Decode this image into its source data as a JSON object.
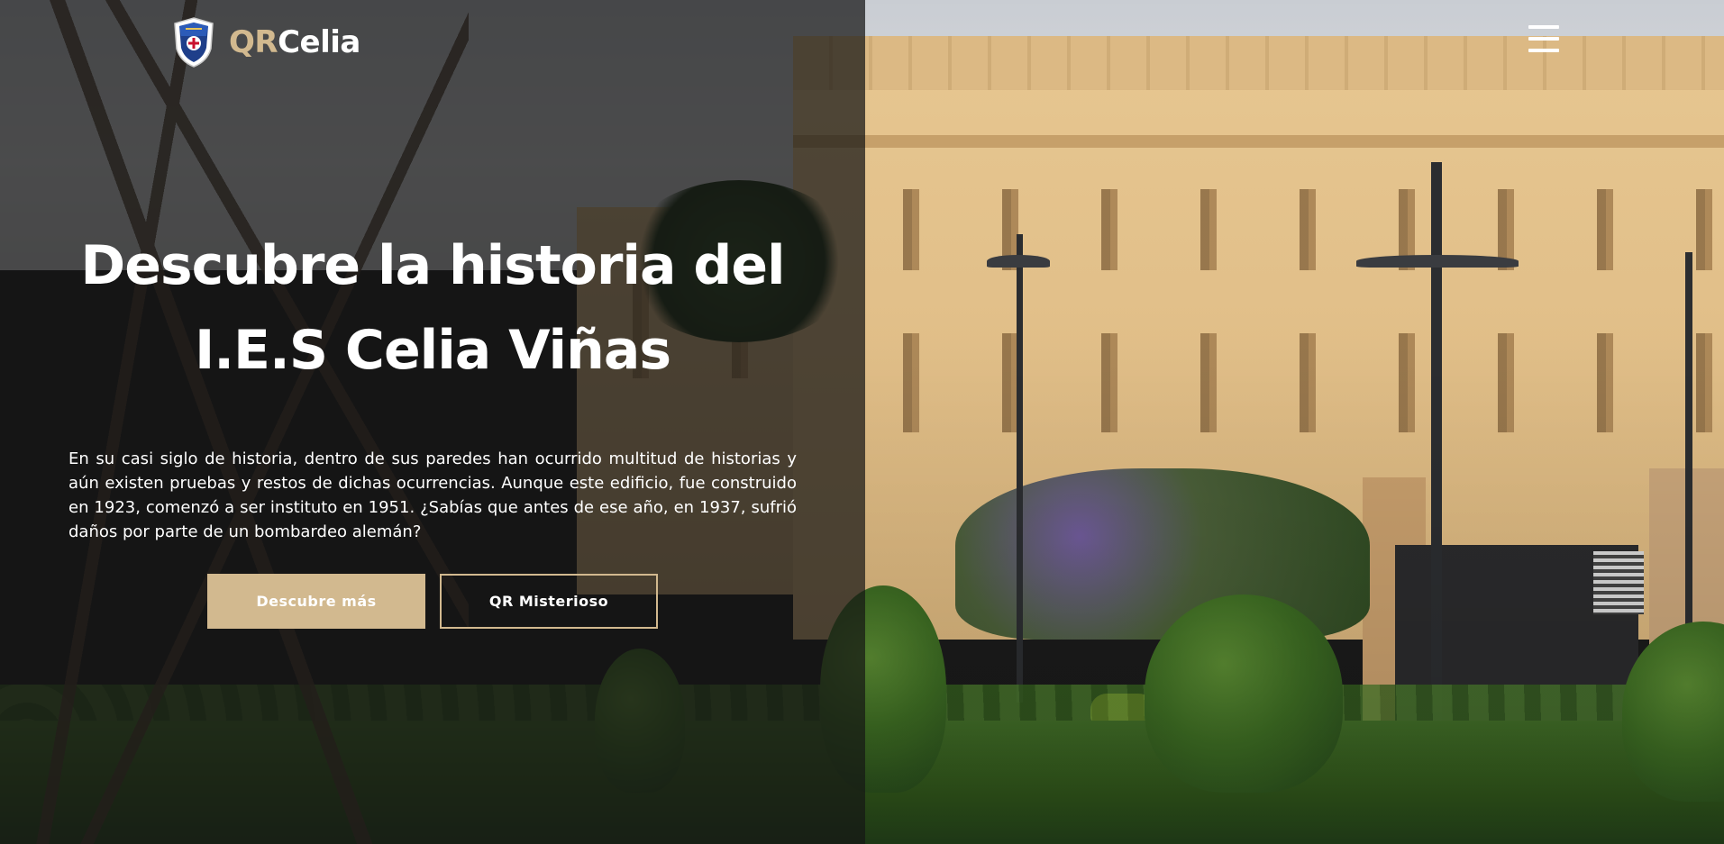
{
  "header": {
    "logo_icon": "school-crest-icon",
    "brand_accent": "QR",
    "brand_main": "Celia",
    "menu_icon": "hamburger-menu-icon"
  },
  "hero": {
    "title_line1": "Descubre la historia del",
    "title_line2": "I.E.S Celia Viñas",
    "description": "En su casi siglo de historia, dentro de sus paredes han ocurrido multitud de historias y aún existen pruebas y restos de dichas ocurrencias. Aunque este edificio, fue construido en 1923, comenzó a ser instituto en 1951. ¿Sabías que antes de ese año, en 1937, sufrió daños por parte de un bombardeo alemán?",
    "primary_button": "Descubre más",
    "secondary_button": "QR Misterioso"
  },
  "colors": {
    "accent": "#d2b98f",
    "text": "#ffffff",
    "overlay": "#141414"
  }
}
